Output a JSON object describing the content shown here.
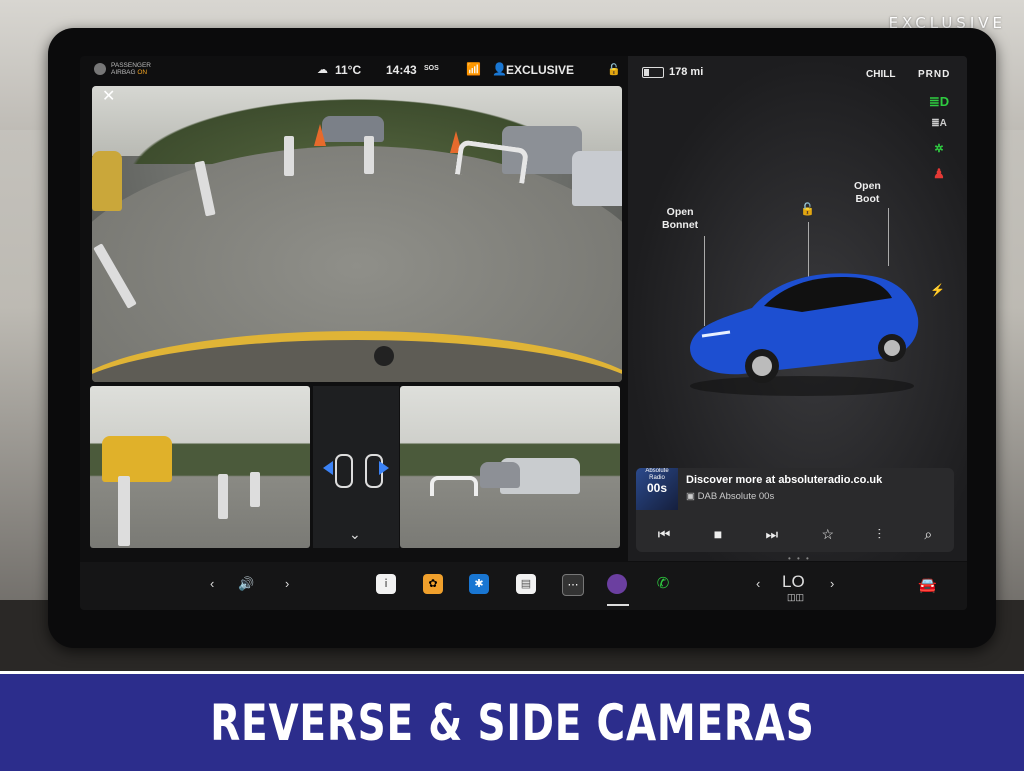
{
  "brand": "EXCLUSIVE",
  "status_bar": {
    "airbag_line1": "PASSENGER",
    "airbag_line2": "AIRBAG",
    "airbag_state": "ON",
    "temperature": "11°C",
    "time": "14:43",
    "sos": "SOS",
    "profile": "EXCLUSIVE"
  },
  "vehicle": {
    "range": "178 mi",
    "drive_mode": "CHILL",
    "gears": "PRND",
    "open_bonnet": [
      "Open",
      "Bonnet"
    ],
    "open_boot": [
      "Open",
      "Boot"
    ],
    "car_color": "#1d4fd1"
  },
  "media": {
    "album_line1": "Absolute",
    "album_line2": "Radio",
    "album_big": "00s",
    "title": "Discover more at absoluteradio.co.uk",
    "station": "DAB Absolute 00s"
  },
  "taskbar": {
    "climate_level": "LO"
  },
  "banner": {
    "text": "REVERSE & SIDE CAMERAS"
  },
  "colors": {
    "banner_bg": "#2c2d8c",
    "airbag_on": "#f5a623",
    "indicator_green": "#2ecc40",
    "indicator_red": "#e53935"
  }
}
